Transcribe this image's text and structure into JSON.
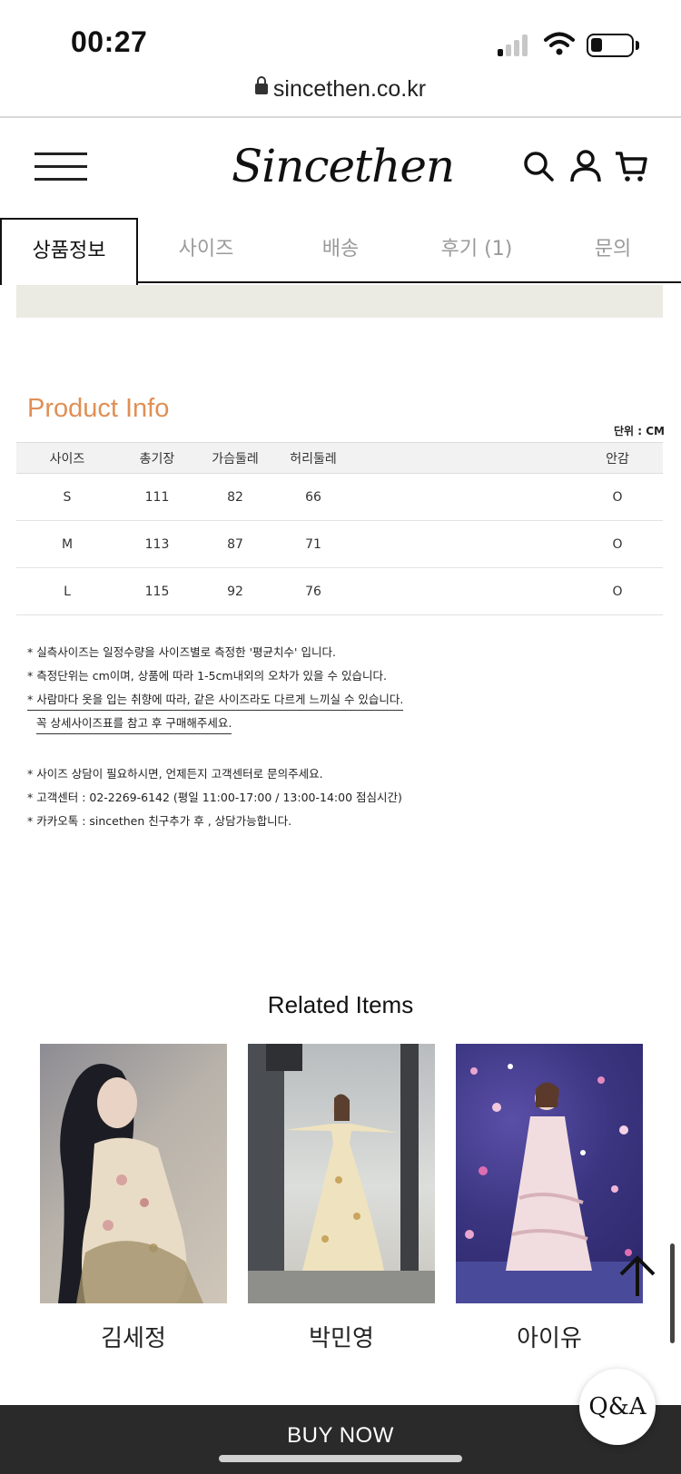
{
  "status_bar": {
    "time": "00:27"
  },
  "browser": {
    "url": "sincethen.co.kr"
  },
  "header": {
    "logo": "Sincethen"
  },
  "tabs": [
    {
      "label": "상품정보"
    },
    {
      "label": "사이즈"
    },
    {
      "label": "배송"
    },
    {
      "label": "후기 (1)"
    },
    {
      "label": "문의"
    }
  ],
  "product_info": {
    "title": "Product Info",
    "unit": "단위 : CM",
    "headers": [
      "사이즈",
      "총기장",
      "가슴둘레",
      "허리둘레",
      "안감"
    ],
    "rows": [
      [
        "S",
        "111",
        "82",
        "66",
        "O"
      ],
      [
        "M",
        "113",
        "87",
        "71",
        "O"
      ],
      [
        "L",
        "115",
        "92",
        "76",
        "O"
      ]
    ]
  },
  "notes": {
    "n1": "* 실측사이즈는 일정수량을 사이즈별로 측정한 '평균치수' 입니다.",
    "n2": "* 측정단위는 cm이며, 상품에 따라 1-5cm내외의 오차가 있을 수 있습니다.",
    "n3": "* 사람마다 옷을 입는 취향에 따라, 같은 사이즈라도 다르게 느끼실 수 있습니다.",
    "n4": "꼭 상세사이즈표를 참고 후 구매해주세요.",
    "n5": "* 사이즈 상담이 필요하시면, 언제든지 고객센터로 문의주세요.",
    "n6": "* 고객센터 : 02-2269-6142 (평일 11:00-17:00 / 13:00-14:00 점심시간)",
    "n7": "* 카카오톡 : sincethen 친구추가 후 , 상담가능합니다."
  },
  "related": {
    "title": "Related Items",
    "items": [
      {
        "name": "김세정"
      },
      {
        "name": "박민영"
      },
      {
        "name": "아이유"
      }
    ]
  },
  "qa_button": "Q&A",
  "buy_button": "BUY NOW"
}
